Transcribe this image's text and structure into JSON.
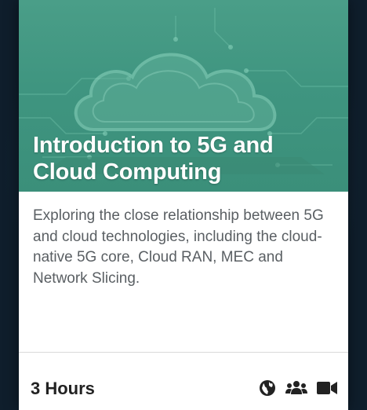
{
  "course_card": {
    "title": "Introduction to 5G and Cloud Computing",
    "description": "Exploring the close relationship between 5G and cloud technologies, including the cloud-native 5G core, Cloud RAN, MEC and Network Slicing.",
    "duration": "3 Hours",
    "icons": [
      "globe-icon",
      "users-icon",
      "video-camera-icon"
    ]
  },
  "colors": {
    "hero_teal": "#3f9580",
    "title_text": "#ffffff",
    "body_text": "#5a5f63",
    "background": "#0f1e2c"
  }
}
